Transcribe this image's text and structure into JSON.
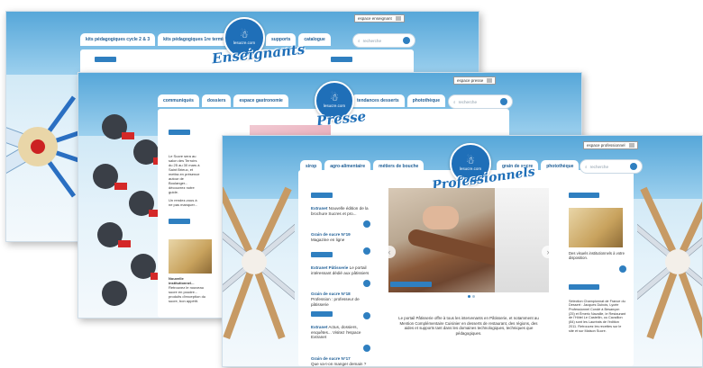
{
  "screens": {
    "enseignants": {
      "dropdown": "espace enseignant",
      "tabs": [
        "kits pédagogiques cycle 2 & 3",
        "kits pédagogiques 1re terminale",
        "supports",
        "catalogue"
      ],
      "search_placeholder": "recherche",
      "logo_text": "lesucre.com",
      "script_title": "Enseignants"
    },
    "presse": {
      "dropdown": "espace presse",
      "tabs": [
        "communiqués",
        "dossiers",
        "espace gastronomie",
        "tendances desserts",
        "photothèque"
      ],
      "search_placeholder": "recherche",
      "logo_text": "lesucre.com",
      "script_title": "Presse",
      "snippet_text": "Le Sucre sera au salon des Terroirs du 25 au 30 mars à Saint Brieuc, et mettra en présence autour de Boulanger... découvrez notre guide.",
      "snippet_more": "Un rendez-vous à ne pas manquer...",
      "product_title": "Nouvelle institutionnel...",
      "product_text": "Retrouvez le nouveau sucre en poudre... produits d'exception du sucre, bon appétit."
    },
    "professionnels": {
      "dropdown": "espace professionnel",
      "tabs": [
        "sirop",
        "agro-alimentaire",
        "métiers de bouche",
        "grain de sucre",
        "photothèque"
      ],
      "search_placeholder": "recherche",
      "logo_text": "lesucre.com",
      "script_title": "Professionnels",
      "left_items": [
        {
          "title": "Extranet",
          "text": "Nouvelle édition de la brochure Sucres et pro..."
        },
        {
          "title": "Grain de sucre N°19",
          "text": "Magazine en ligne"
        },
        {
          "title": "Extranet Pâtisserie",
          "text": "Le portail intéressant dédié aux pâtissiers"
        },
        {
          "title": "Grain de sucre N°18",
          "text": "Profession : professeur de pâtisserie"
        },
        {
          "title": "Extranet",
          "text": "Actus, dossiers, enquêtes... Visitez l'espace Extranet"
        },
        {
          "title": "Grain de sucre N°17",
          "text": "Que va-t-on manger demain ?"
        }
      ],
      "intro_text": "Le portail Pâtisserie offre à tous les intervenants en Pâtisserie, et notamment au Mention Complémentaire Cuisinier en desserts de restaurant, des régions, des aides et supports tant dans les domaines technologiques, techniques que pédagogiques.",
      "right_card_text": "Des visuels institutionnels à votre disposition.",
      "right_text": "Sélection Championnat de France du Dessert : Jacques Dubois, Lycée Professionnel Condé à Besançon (25) et Émeric Navaille, le Restaurant de l'Hôtel Le Castellin, ou Cavaillon (84) sont les Lauréats de l'édition 2011. Retrouvez les recettes sur le site et sur Maison Sucre."
    }
  }
}
